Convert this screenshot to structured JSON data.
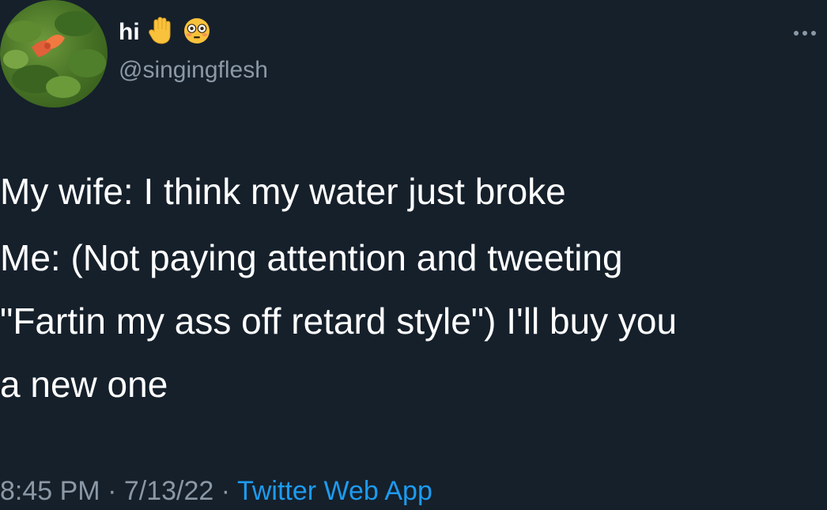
{
  "author": {
    "display_name": "hi",
    "handle": "@singingflesh",
    "emojis": [
      "raised-hand-icon",
      "flushed-face-icon"
    ]
  },
  "tweet": {
    "lines": [
      "My wife: I think my water just broke",
      "Me: (Not paying attention and tweeting",
      "\"Fartin my ass off retard style\") I'll buy you",
      "a new one"
    ]
  },
  "meta": {
    "time": "8:45 PM",
    "separator": "·",
    "date": "7/13/22",
    "source": "Twitter Web App"
  },
  "colors": {
    "background": "#15202b",
    "text": "#ffffff",
    "muted": "#8b98a5",
    "link": "#1d9bf0"
  }
}
